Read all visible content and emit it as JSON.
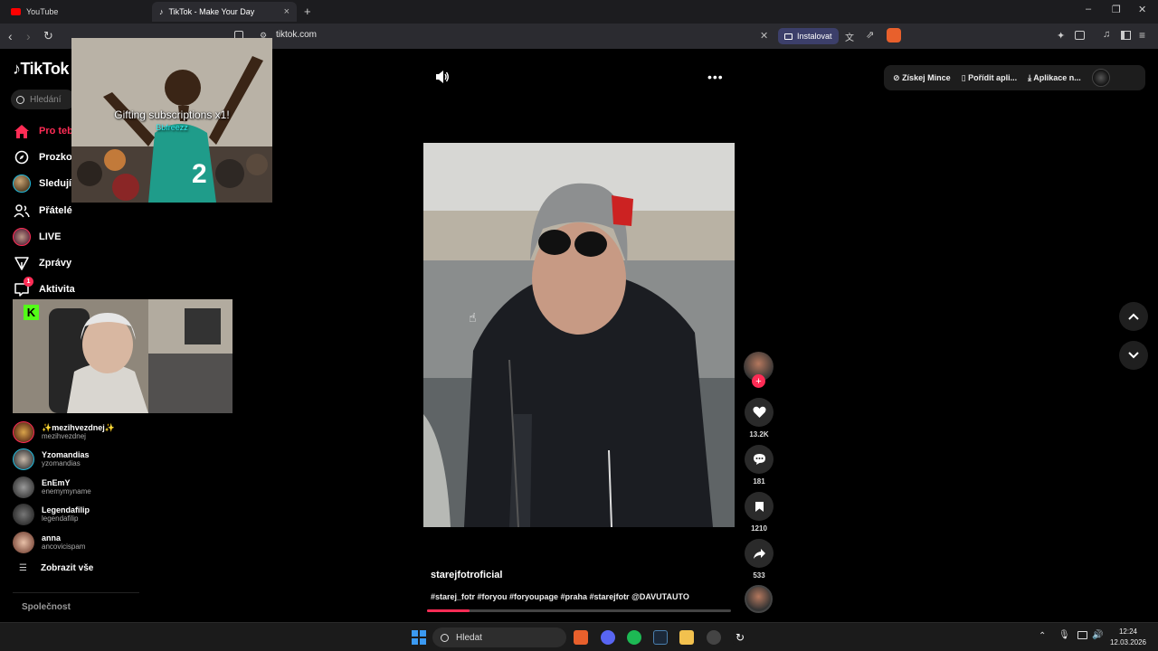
{
  "browser": {
    "tabs": [
      {
        "title": "YouTube"
      },
      {
        "title": "TikTok - Make Your Day"
      }
    ],
    "new_tab": "+",
    "url": "tiktok.com",
    "install_label": "Instalovat"
  },
  "tiktok": {
    "logo": "TikTok",
    "search_placeholder": "Hledání",
    "nav": [
      {
        "label": "Pro tebe",
        "icon": "home-icon"
      },
      {
        "label": "Prozkoumat",
        "icon": "compass-icon"
      },
      {
        "label": "Sledující",
        "icon": "following-avatar"
      },
      {
        "label": "Přátelé",
        "icon": "friends-icon"
      },
      {
        "label": "LIVE",
        "icon": "live-avatar"
      },
      {
        "label": "Zprávy",
        "icon": "send-icon"
      },
      {
        "label": "Aktivita",
        "icon": "activity-icon",
        "badge": "1"
      }
    ],
    "following": [
      {
        "name": "✨mezihvezdnej✨",
        "username": "mezihvezdnej"
      },
      {
        "name": "Yzomandias",
        "username": "yzomandias"
      },
      {
        "name": "EnEmY",
        "username": "enemymyname"
      },
      {
        "name": "Legendafilip",
        "username": "legendafilip"
      },
      {
        "name": "anna",
        "username": "ancovicispam"
      }
    ],
    "show_all": "Zobrazit vše",
    "footer": "Společnost",
    "top_links": [
      "Získej Mince",
      "Pořídit apli...",
      "Aplikace n..."
    ],
    "video": {
      "author": "starejfotroficial",
      "description": "#starej_fotr #foryou #foryoupage #praha #starejfotr @DAVUTAUTO",
      "progress": 0.14,
      "likes": "13.2K",
      "comments": "181",
      "saves": "1210",
      "shares": "533"
    }
  },
  "overlay": {
    "text": "Gifting subscriptions x1!",
    "sub": "Bbfreezz",
    "jersey": "2"
  },
  "taskbar": {
    "search_label": "Hledat",
    "time": "12:24",
    "date": "12.03.2026"
  }
}
